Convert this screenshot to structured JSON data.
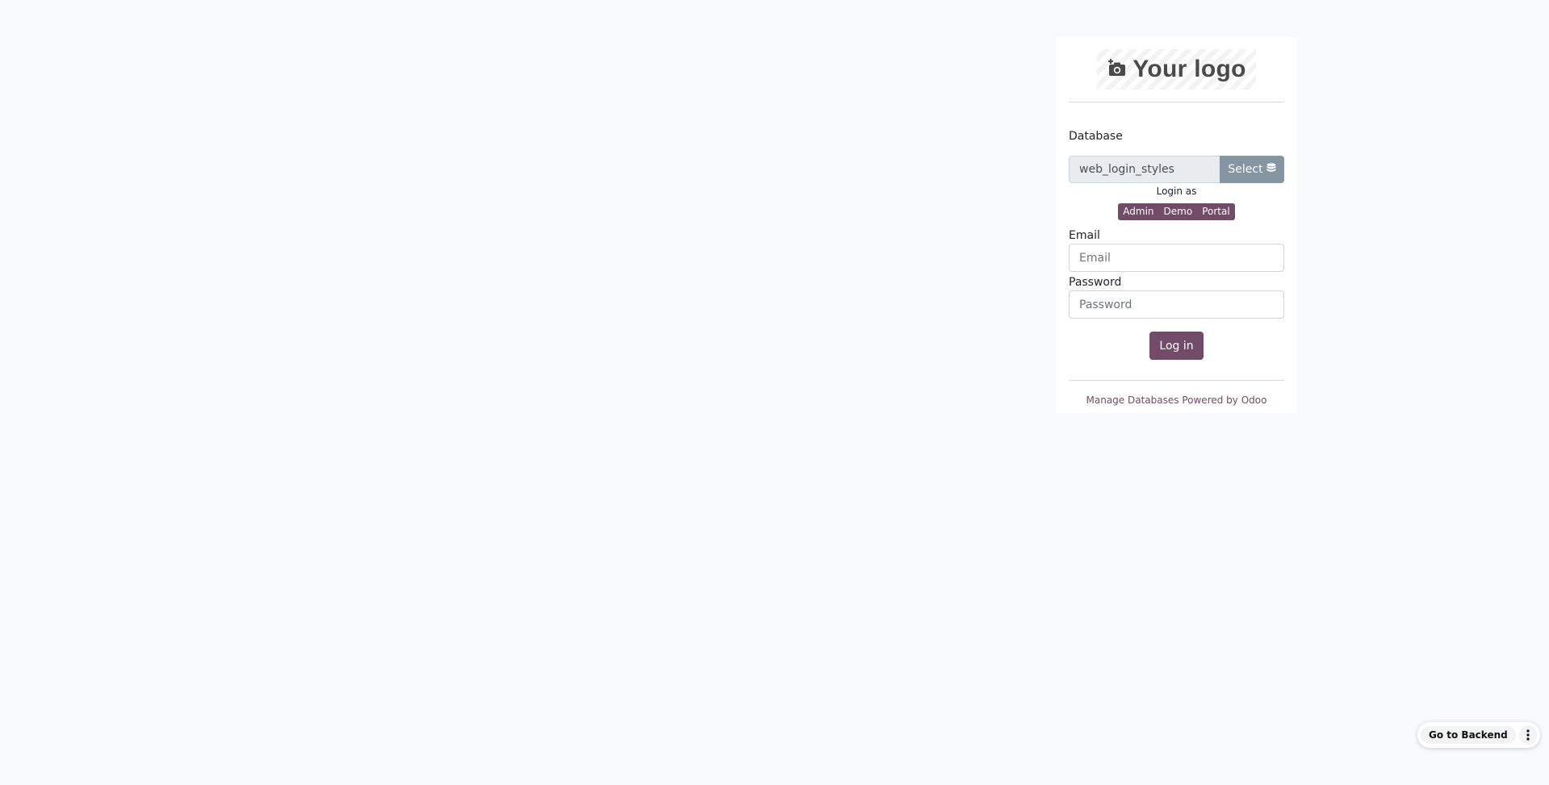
{
  "logo": {
    "text": "Your logo",
    "icon": "camera-plus-icon"
  },
  "database": {
    "label": "Database",
    "value": "web_login_styles",
    "select_label": "Select",
    "select_icon": "database-icon"
  },
  "login_as": {
    "label": "Login as",
    "users": [
      "Admin",
      "Demo",
      "Portal"
    ]
  },
  "email": {
    "label": "Email",
    "placeholder": "Email"
  },
  "password": {
    "label": "Password",
    "placeholder": "Password"
  },
  "login_button": "Log in",
  "footer": {
    "manage_databases": "Manage Databases",
    "powered_by": "Powered by Odoo"
  },
  "floating": {
    "backend_label": "Go to Backend",
    "menu_icon": "kebab-menu-icon"
  },
  "colors": {
    "brand": "#714b67",
    "select_button": "#8595a2",
    "background": "#f8f9fa"
  }
}
